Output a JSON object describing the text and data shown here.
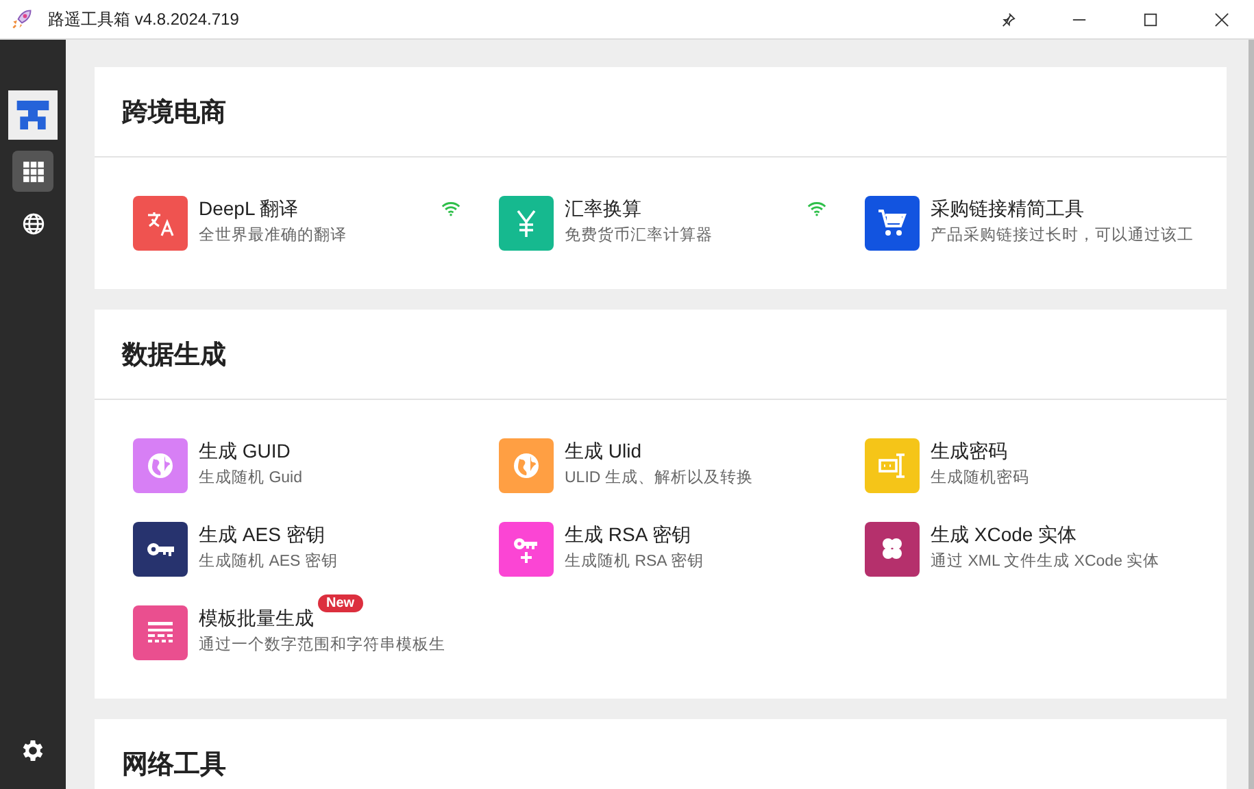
{
  "window": {
    "title": "路遥工具箱 v4.8.2024.719"
  },
  "sidebar": {
    "items": [
      {
        "kind": "grid",
        "selected": true
      },
      {
        "kind": "globe",
        "selected": false
      }
    ]
  },
  "sections": [
    {
      "title": "跨境电商",
      "items": [
        {
          "kind": "translate",
          "color": "#ef5350",
          "title": "DeepL 翻译",
          "description": "全世界最准确的翻译",
          "online": true
        },
        {
          "kind": "yen",
          "color": "#16b98f",
          "title": "汇率换算",
          "description": "免费货币汇率计算器",
          "online": true
        },
        {
          "kind": "cart",
          "color": "#1254e0",
          "title": "采购链接精简工具",
          "description": "产品采购链接过长时，可以通过该工",
          "online": false
        }
      ]
    },
    {
      "title": "数据生成",
      "items": [
        {
          "kind": "globe",
          "color": "#d77ff5",
          "title": "生成 GUID",
          "description": "生成随机 Guid",
          "online": false
        },
        {
          "kind": "globe",
          "color": "#ff9f43",
          "title": "生成 Ulid",
          "description": "ULID 生成、解析以及转换",
          "online": false
        },
        {
          "kind": "password",
          "color": "#f5c518",
          "title": "生成密码",
          "description": "生成随机密码",
          "online": false
        },
        {
          "kind": "key",
          "color": "#27336e",
          "title": "生成 AES 密钥",
          "description": "生成随机 AES 密钥",
          "online": false
        },
        {
          "kind": "key-plus",
          "color": "#fb45d4",
          "title": "生成 RSA 密钥",
          "description": "生成随机 RSA 密钥",
          "online": false
        },
        {
          "kind": "clover",
          "color": "#b5306c",
          "title": "生成 XCode 实体",
          "description": "通过 XML 文件生成 XCode 实体",
          "online": false
        },
        {
          "kind": "table",
          "color": "#ea4f8f",
          "title": "模板批量生成",
          "description": "通过一个数字范围和字符串模板生",
          "online": false,
          "badge": "New"
        }
      ]
    },
    {
      "title": "网络工具"
    }
  ]
}
